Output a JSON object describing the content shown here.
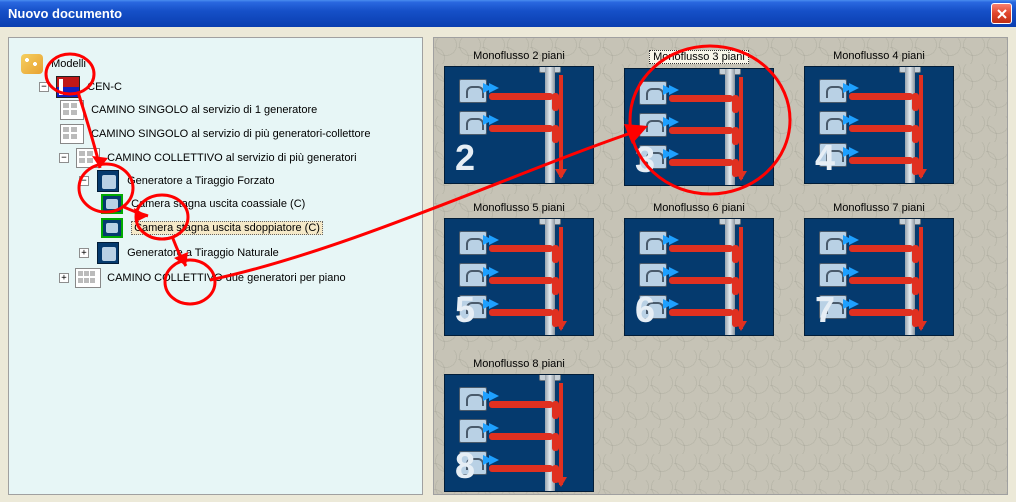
{
  "window": {
    "title": "Nuovo documento"
  },
  "tree": {
    "root": "Modelli",
    "app": "CEN-C",
    "n1": "CAMINO  SINGOLO al servizio di 1 generatore",
    "n2": "CAMINO  SINGOLO al servizio di più generatori-collettore",
    "n3": "CAMINO COLLETTIVO al servizio di più generatori",
    "n3a": "Generatore a Tiraggio Forzato",
    "n3a1": "Camera stagna uscita coassiale (C)",
    "n3a2": "Camera stagna uscita sdoppiatore (C)",
    "n3b": "Generatore a Tiraggio Naturale",
    "n4": "CAMINO COLLETTIVO due generatori per piano"
  },
  "thumbs": [
    {
      "caption": "Monoflusso 2 piani",
      "num": "2",
      "rows": 2
    },
    {
      "caption": "Monoflusso 3 piani",
      "num": "3",
      "rows": 3,
      "selected": true
    },
    {
      "caption": "Monoflusso 4 piani",
      "num": "4",
      "rows": 3
    },
    {
      "caption": "Monoflusso 5 piani",
      "num": "5",
      "rows": 3
    },
    {
      "caption": "Monoflusso 6 piani",
      "num": "6",
      "rows": 3
    },
    {
      "caption": "Monoflusso 7 piani",
      "num": "7",
      "rows": 3
    },
    {
      "caption": "Monoflusso 8 piani",
      "num": "8",
      "rows": 3
    }
  ]
}
